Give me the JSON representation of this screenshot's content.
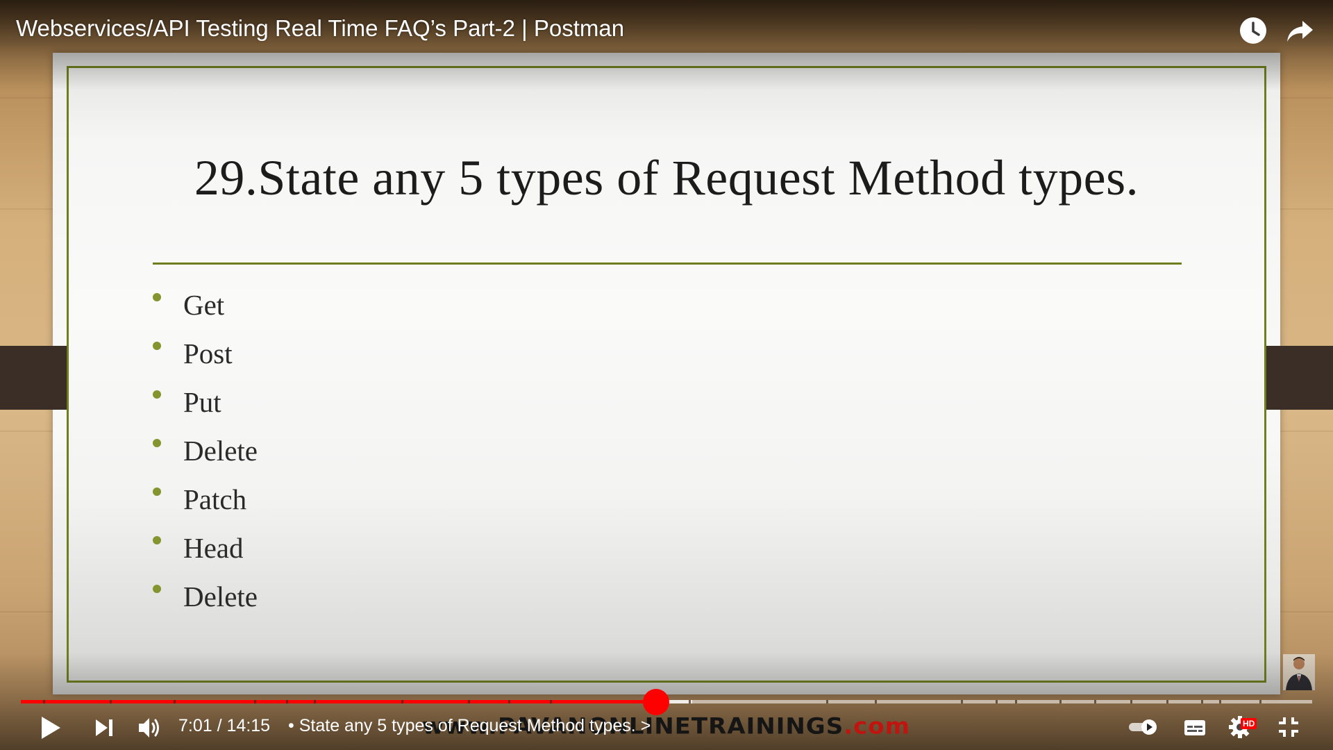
{
  "player": {
    "title": "Webservices/API Testing Real Time FAQ’s Part-2 | Postman",
    "current_time": "7:01",
    "time_separator": " / ",
    "duration": "14:15",
    "chapter_prefix": "•",
    "chapter_title": "State any 5 types of Request Method types.",
    "chapter_arrow": ">",
    "progress_fraction": 0.492,
    "buffered_fraction": 0.52,
    "hd_badge": "HD",
    "accent_color": "#ff0000"
  },
  "slide": {
    "title": "29.State any 5 types of Request Method types.",
    "bullets": [
      "Get",
      "Post",
      "Put",
      "Delete",
      "Patch",
      "Head",
      "Delete"
    ],
    "accent_color": "#6e7d1e"
  },
  "watermark": {
    "main": "www.PAVANONLINETRAININGS",
    "accent": ".com"
  },
  "icons": {
    "watch_later": "clock-icon",
    "share": "share-icon",
    "play": "play-icon",
    "next": "next-icon",
    "volume": "volume-icon",
    "autoplay": "autoplay-toggle-icon",
    "subtitles": "subtitles-icon",
    "settings": "gear-icon",
    "exit_fullscreen": "exit-fullscreen-icon"
  }
}
